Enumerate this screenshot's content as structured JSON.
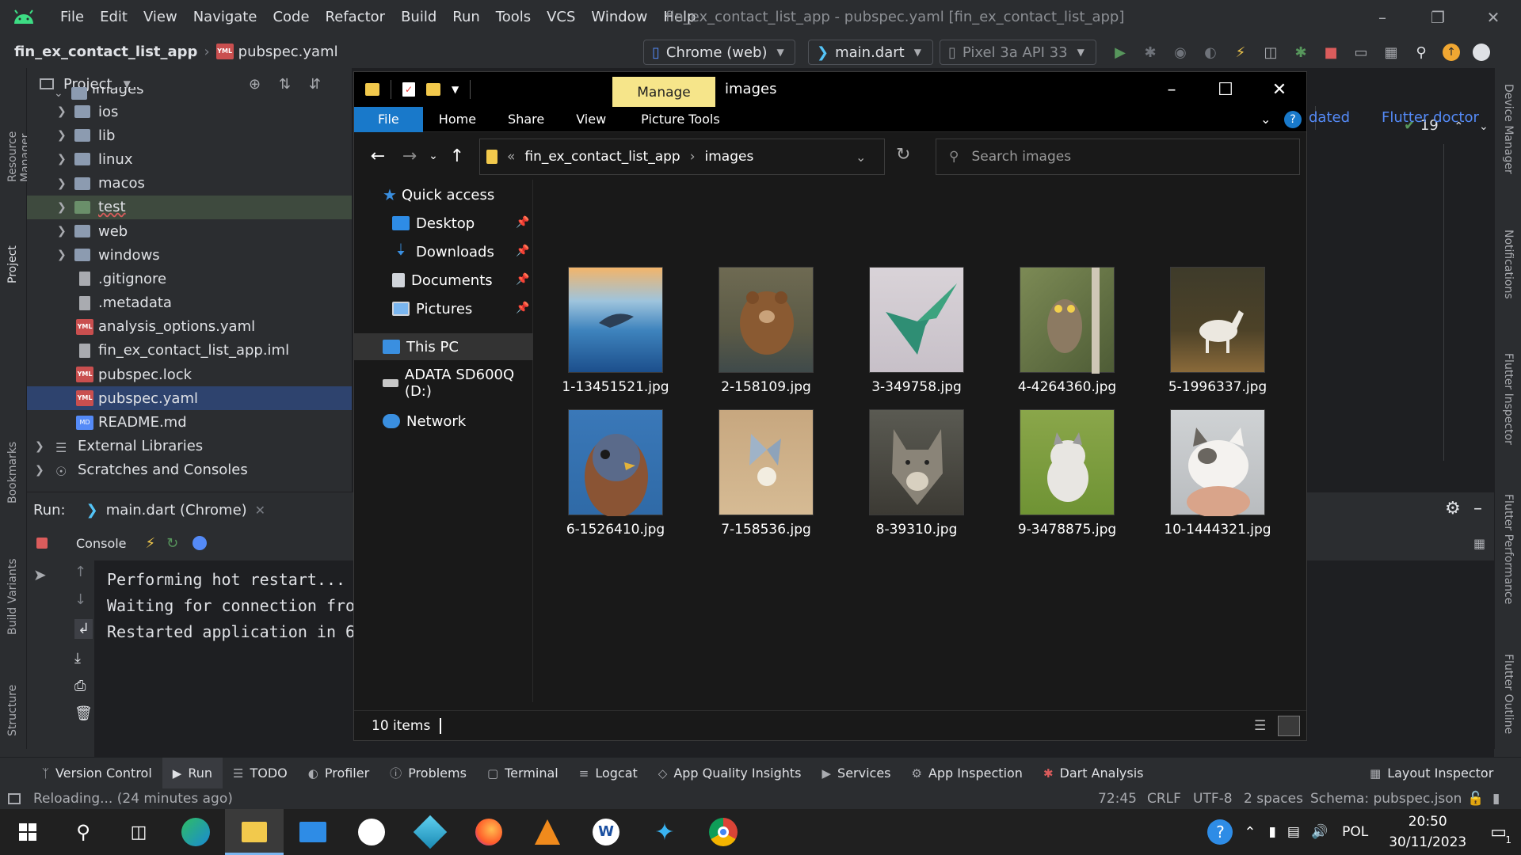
{
  "android_studio": {
    "menu": [
      "File",
      "Edit",
      "View",
      "Navigate",
      "Code",
      "Refactor",
      "Build",
      "Run",
      "Tools",
      "VCS",
      "Window",
      "Help"
    ],
    "window_title": "fin_ex_contact_list_app - pubspec.yaml [fin_ex_contact_list_app]",
    "breadcrumb": {
      "project": "fin_ex_contact_list_app",
      "file": "pubspec.yaml",
      "file_badge": "YML"
    },
    "toolbar": {
      "device_target": "Chrome (web)",
      "run_config": "main.dart",
      "emulator": "Pixel 3a API 33"
    },
    "left_strip": [
      "Resource Manager",
      "Project",
      "Bookmarks",
      "Build Variants",
      "Structure"
    ],
    "right_strip": [
      "Device Manager",
      "Notifications",
      "Flutter Inspector",
      "Flutter Performance",
      "Flutter Outline"
    ],
    "project_panel": {
      "title": "Project",
      "tree": [
        {
          "label": "images",
          "type": "folder"
        },
        {
          "label": "ios",
          "type": "folder"
        },
        {
          "label": "lib",
          "type": "folder"
        },
        {
          "label": "linux",
          "type": "folder"
        },
        {
          "label": "macos",
          "type": "folder"
        },
        {
          "label": "test",
          "type": "folder"
        },
        {
          "label": "web",
          "type": "folder"
        },
        {
          "label": "windows",
          "type": "folder"
        },
        {
          "label": ".gitignore",
          "type": "file"
        },
        {
          "label": ".metadata",
          "type": "file"
        },
        {
          "label": "analysis_options.yaml",
          "type": "yml"
        },
        {
          "label": "fin_ex_contact_list_app.iml",
          "type": "file"
        },
        {
          "label": "pubspec.lock",
          "type": "yml"
        },
        {
          "label": "pubspec.yaml",
          "type": "yml"
        },
        {
          "label": "README.md",
          "type": "md"
        },
        {
          "label": "External Libraries",
          "type": "lib"
        },
        {
          "label": "Scratches and Consoles",
          "type": "scratch"
        }
      ]
    },
    "editor": {
      "link_updated": "dated",
      "link_doctor": "Flutter doctor",
      "check_count": "19"
    },
    "run_panel": {
      "label": "Run:",
      "tab": "main.dart (Chrome)",
      "console_tab": "Console",
      "console_lines": [
        "Performing hot restart...",
        "Waiting for connection fro",
        "Restarted application in 6"
      ]
    },
    "tool_tabs": [
      "Version Control",
      "Run",
      "TODO",
      "Profiler",
      "Problems",
      "Terminal",
      "Logcat",
      "App Quality Insights",
      "Services",
      "App Inspection",
      "Dart Analysis"
    ],
    "tool_tab_right": "Layout Inspector",
    "status": {
      "message": "Reloading... (24 minutes ago)",
      "position": "72:45",
      "line_sep": "CRLF",
      "encoding": "UTF-8",
      "indent": "2 spaces",
      "schema": "Schema: pubspec.json"
    }
  },
  "explorer": {
    "folder_title": "images",
    "manage_tab": "Manage",
    "ribbon": [
      "File",
      "Home",
      "Share",
      "View",
      "Picture Tools"
    ],
    "address": {
      "prefix": "«",
      "parent": "fin_ex_contact_list_app",
      "current": "images"
    },
    "search_placeholder": "Search images",
    "nav": {
      "quick_access": "Quick access",
      "pinned": [
        "Desktop",
        "Downloads",
        "Documents",
        "Pictures"
      ],
      "this_pc": "This PC",
      "drive": "ADATA SD600Q (D:)",
      "network": "Network"
    },
    "files": [
      {
        "name": "1-13451521.jpg",
        "subject": "dolphin"
      },
      {
        "name": "2-158109.jpg",
        "subject": "bear"
      },
      {
        "name": "3-349758.jpg",
        "subject": "hummingbird"
      },
      {
        "name": "4-4264360.jpg",
        "subject": "owl"
      },
      {
        "name": "5-1996337.jpg",
        "subject": "horse"
      },
      {
        "name": "6-1526410.jpg",
        "subject": "kestrel"
      },
      {
        "name": "7-158536.jpg",
        "subject": "butterfly"
      },
      {
        "name": "8-39310.jpg",
        "subject": "wolf"
      },
      {
        "name": "9-3478875.jpg",
        "subject": "husky puppy"
      },
      {
        "name": "10-1444321.jpg",
        "subject": "kitten"
      }
    ],
    "item_count": "10 items"
  },
  "taskbar": {
    "language": "POL",
    "time": "20:50",
    "date": "30/11/2023",
    "notification_count": "1"
  }
}
